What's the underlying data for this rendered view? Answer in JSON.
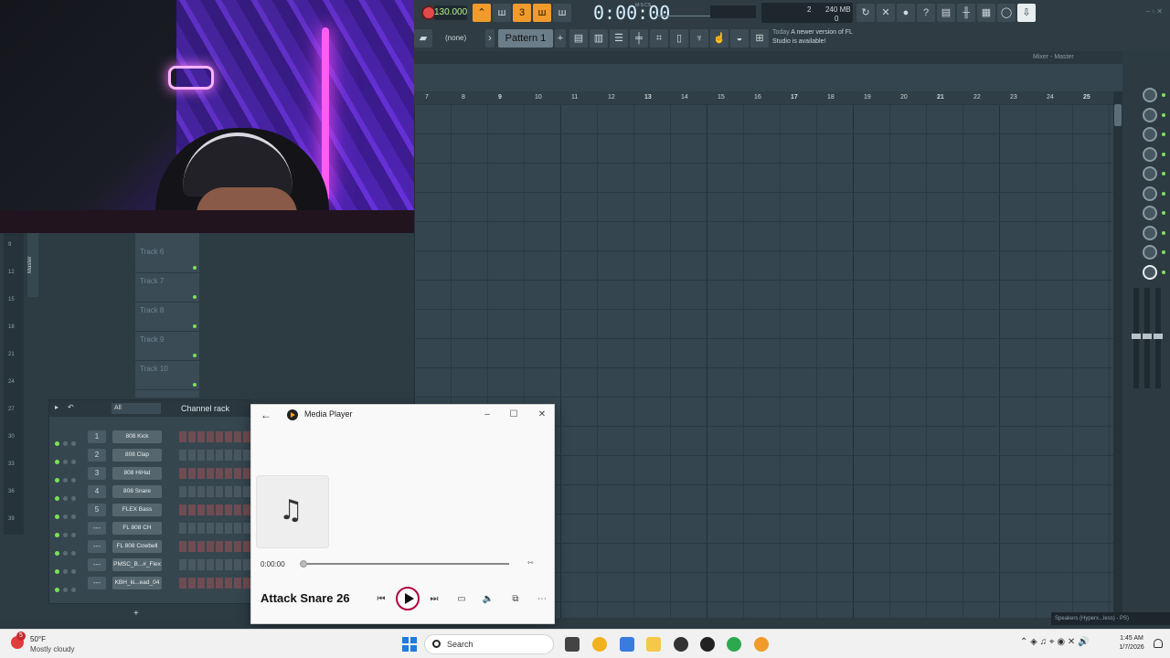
{
  "toolbar": {
    "tempo": "130.000",
    "time": "0:00:00",
    "time_unit": "M:S:CS",
    "cpu_a": "2",
    "cpu_mem": "240 MB",
    "cpu_poly": "0",
    "pattern_selector": "(none)",
    "pattern_name": "Pattern 1",
    "news_date": "Today",
    "news_text": "A newer version of FL Studio is available!"
  },
  "mixer": {
    "title": "Mixer - Master"
  },
  "playlist": {
    "ruler": [
      "7",
      "8",
      "9",
      "10",
      "11",
      "12",
      "13",
      "14",
      "15",
      "16",
      "17",
      "18",
      "19",
      "20",
      "21",
      "22",
      "23",
      "24",
      "25"
    ],
    "tracks": [
      "Track 6",
      "Track 7",
      "Track 8",
      "Track 9",
      "Track 10"
    ]
  },
  "leftpane": {
    "master_label": "Master",
    "row_numbers": [
      "9",
      "12",
      "15",
      "18",
      "21",
      "24",
      "27",
      "30",
      "33",
      "36",
      "39"
    ]
  },
  "channel_rack": {
    "filter": "All",
    "title": "Channel rack",
    "channels": [
      {
        "num": "1",
        "name": "808 Kick"
      },
      {
        "num": "2",
        "name": "808 Clap"
      },
      {
        "num": "3",
        "name": "808 HiHat"
      },
      {
        "num": "4",
        "name": "808 Snare"
      },
      {
        "num": "5",
        "name": "FLEX Bass"
      },
      {
        "num": "---",
        "name": "FL 808 CH"
      },
      {
        "num": "---",
        "name": "FL 808 Cowbell"
      },
      {
        "num": "---",
        "name": "PMSC_B...#_Flex"
      },
      {
        "num": "---",
        "name": "KBH_ki...ead_04"
      }
    ],
    "add": "+"
  },
  "media_player": {
    "title": "Media Player",
    "current_time": "0:00:00",
    "song": "Attack Snare 26",
    "progress": 0
  },
  "taskbar": {
    "weather_temp": "50°F",
    "weather_desc": "Mostly cloudy",
    "weather_badge": "5",
    "search_placeholder": "Search",
    "clock_time": "1:45 AM",
    "clock_date": "1/7/2026"
  },
  "status_strip": "Speakers (Hyperx...less) - PS)",
  "colors": {
    "accent": "#f19b2c",
    "fl_bg": "#34454f",
    "led_green": "#7be05b"
  }
}
